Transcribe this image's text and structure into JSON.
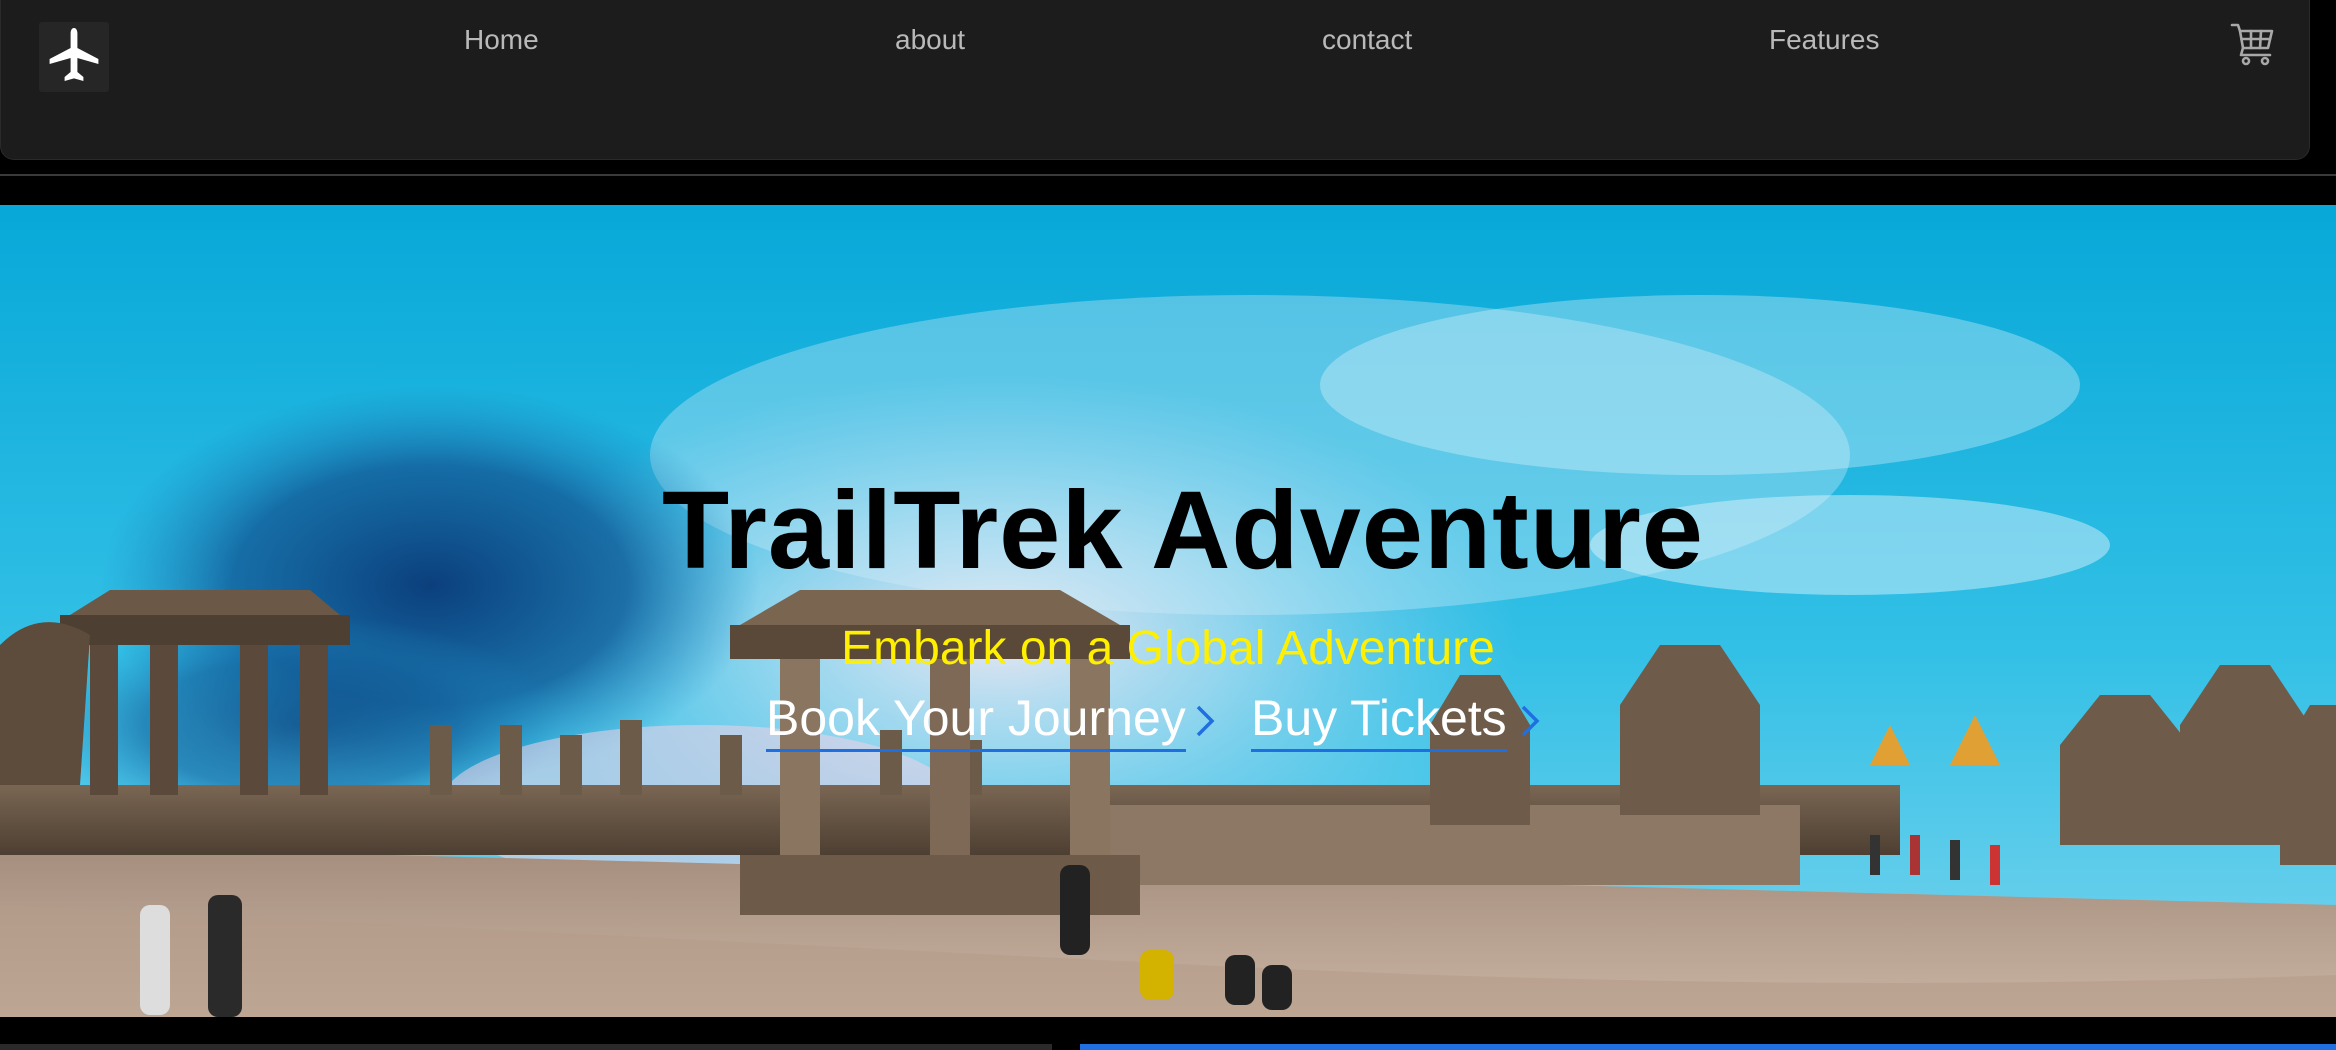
{
  "nav": {
    "logo_icon": "airplane-icon",
    "links": [
      {
        "label": "Home"
      },
      {
        "label": "about"
      },
      {
        "label": "contact"
      },
      {
        "label": "Features"
      }
    ],
    "cart_icon": "shopping-cart-icon"
  },
  "hero": {
    "title": "TrailTrek Adventure",
    "subtitle": "Embark on a Global Adventure",
    "buttons": [
      {
        "label": "Book Your Journey",
        "icon": "chevron-right-icon"
      },
      {
        "label": "Buy Tickets",
        "icon": "chevron-right-icon"
      }
    ]
  },
  "colors": {
    "nav_bg": "#1c1c1c",
    "nav_text": "#b9b9b9",
    "title": "#000000",
    "subtitle": "#ffef00",
    "accent": "#1f6fe0",
    "sky": "#1eb3dc"
  }
}
